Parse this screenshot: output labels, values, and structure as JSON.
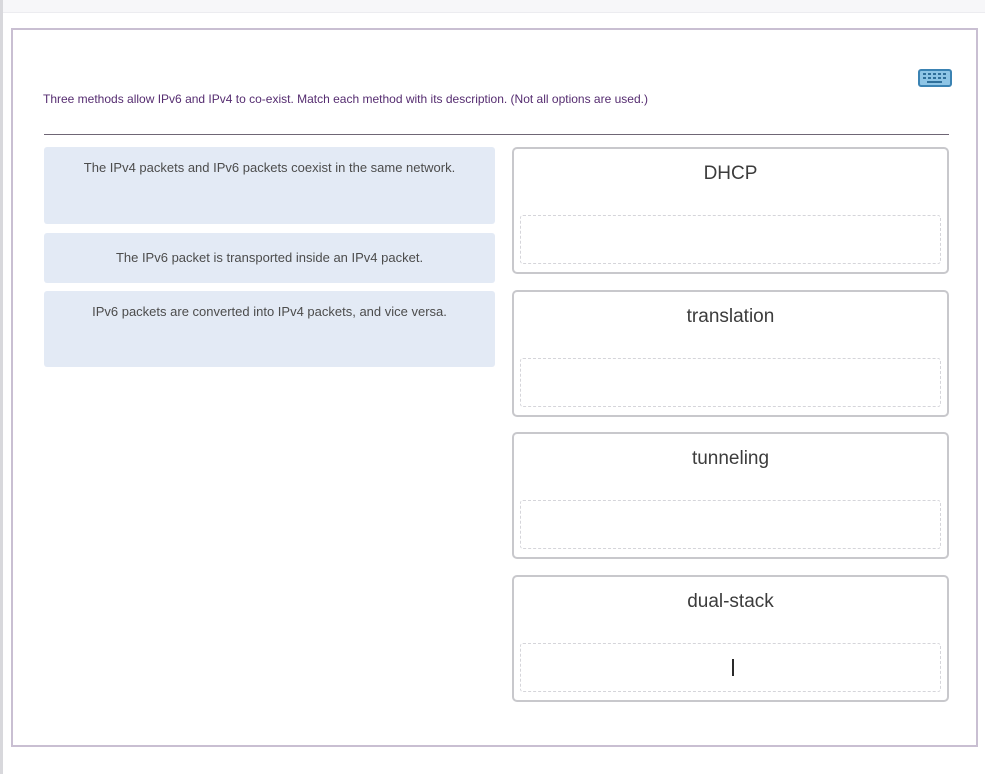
{
  "question": {
    "prompt": "Three methods allow IPv6 and IPv4 to co-exist. Match each method with its description. (Not all options are used.)"
  },
  "descriptions": [
    {
      "text": "The IPv4 packets and IPv6 packets coexist in the same network."
    },
    {
      "text": "The IPv6 packet is transported inside an IPv4 packet."
    },
    {
      "text": "IPv6 packets are converted into IPv4 packets, and vice versa."
    }
  ],
  "targets": [
    {
      "label": "DHCP"
    },
    {
      "label": "translation"
    },
    {
      "label": "tunneling"
    },
    {
      "label": "dual-stack"
    }
  ],
  "icons": {
    "keyboard": "keyboard-icon"
  },
  "colors": {
    "prompt_text": "#552c70",
    "description_card_bg": "#e3eaf5",
    "panel_border": "#c9bfd2",
    "keyboard_icon": "#8ec5e6"
  }
}
